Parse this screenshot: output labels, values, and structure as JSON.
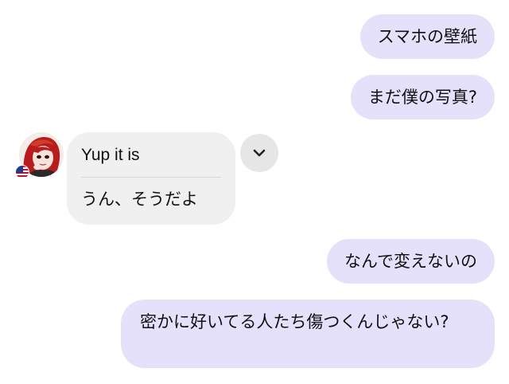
{
  "messages": {
    "out1": "スマホの壁紙",
    "out2": "まだ僕の写真?",
    "in_original": "Yup it is",
    "in_translation": "うん、そうだよ",
    "out3": "なんで変えないの",
    "out4": "密かに好いてる人たち傷つくんじゃない?"
  },
  "colors": {
    "outgoing_bubble": "#e5e1fb",
    "incoming_bubble": "#f0f0f0",
    "background": "#ffffff",
    "avatar_hair": "#b81c1c"
  },
  "icons": {
    "expand": "chevron-down-icon",
    "flag": "us-flag-icon"
  }
}
